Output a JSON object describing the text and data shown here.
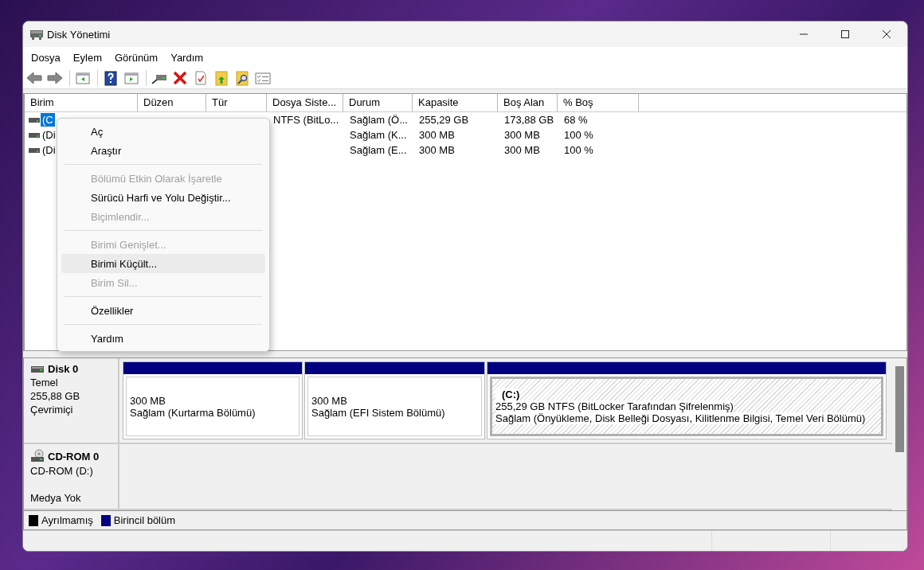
{
  "window": {
    "title": "Disk Yönetimi"
  },
  "menu_bar": [
    "Dosya",
    "Eylem",
    "Görünüm",
    "Yardım"
  ],
  "toolbar": [
    {
      "kind": "back"
    },
    {
      "kind": "forward"
    },
    {
      "kind": "separator"
    },
    {
      "kind": "tree"
    },
    {
      "kind": "separator"
    },
    {
      "kind": "help"
    },
    {
      "kind": "pane"
    },
    {
      "kind": "separator"
    },
    {
      "kind": "drive"
    },
    {
      "kind": "delete"
    },
    {
      "kind": "properties"
    },
    {
      "kind": "folder-up"
    },
    {
      "kind": "folder-search"
    },
    {
      "kind": "list"
    }
  ],
  "volume_table": {
    "columns": [
      "Birim",
      "Düzen",
      "Tür",
      "Dosya Siste...",
      "Durum",
      "Kapasite",
      "Boş Alan",
      "% Boş"
    ],
    "rows": [
      {
        "selected": true,
        "volume": "(C",
        "file_system": "NTFS (BitLo...",
        "status": "Sağlam (Ö...",
        "capacity": "255,29 GB",
        "free_space": "173,88 GB",
        "percent_free": "68 %"
      },
      {
        "selected": false,
        "volume": "(Di",
        "status": "Sağlam (K...",
        "capacity": "300 MB",
        "free_space": "300 MB",
        "percent_free": "100 %"
      },
      {
        "selected": false,
        "volume": "(Di",
        "status": "Sağlam (E...",
        "capacity": "300 MB",
        "free_space": "300 MB",
        "percent_free": "100 %"
      }
    ]
  },
  "context_menu": [
    {
      "kind": "item",
      "label": "Aç",
      "disabled": false,
      "highlighted": false
    },
    {
      "kind": "item",
      "label": "Araştır",
      "disabled": false,
      "highlighted": false
    },
    {
      "kind": "separator"
    },
    {
      "kind": "item",
      "label": "Bölümü Etkin Olarak İşaretle",
      "disabled": true,
      "highlighted": false
    },
    {
      "kind": "item",
      "label": "Sürücü Harfi ve Yolu Değiştir...",
      "disabled": false,
      "highlighted": false
    },
    {
      "kind": "item",
      "label": "Biçimlendir...",
      "disabled": true,
      "highlighted": false
    },
    {
      "kind": "separator"
    },
    {
      "kind": "item",
      "label": "Birimi Genişlet...",
      "disabled": true,
      "highlighted": false
    },
    {
      "kind": "item",
      "label": "Birimi Küçült...",
      "disabled": false,
      "highlighted": true
    },
    {
      "kind": "item",
      "label": "Birim Sil...",
      "disabled": true,
      "highlighted": false
    },
    {
      "kind": "separator"
    },
    {
      "kind": "item",
      "label": "Özellikler",
      "disabled": false,
      "highlighted": false
    },
    {
      "kind": "separator"
    },
    {
      "kind": "item",
      "label": "Yardım",
      "disabled": false,
      "highlighted": false
    }
  ],
  "disks": [
    {
      "kind": "disk",
      "name": "Disk 0",
      "type": "Temel",
      "size": "255,88 GB",
      "state": "Çevrimiçi",
      "partitions": [
        {
          "size": "300 MB",
          "status": "Sağlam (Kurtarma Bölümü)",
          "selected": false,
          "color": "#000080"
        },
        {
          "size": "300 MB",
          "status": "Sağlam (EFI Sistem Bölümü)",
          "selected": false,
          "color": "#000080"
        },
        {
          "label": "(C:)",
          "size": "255,29 GB NTFS (BitLocker Tarafından Şifrelenmiş)",
          "status": "Sağlam (Önyükleme, Disk Belleği Dosyası, Kilitlenme Bilgisi, Temel Veri Bölümü)",
          "selected": true,
          "color": "#000080"
        }
      ]
    },
    {
      "kind": "cdrom",
      "name": "CD-ROM 0",
      "type": "CD-ROM (D:)",
      "state": "Medya Yok"
    }
  ],
  "legend": [
    {
      "label": "Ayrılmamış",
      "color": "#000000"
    },
    {
      "label": "Birincil bölüm",
      "color": "#000080"
    }
  ]
}
